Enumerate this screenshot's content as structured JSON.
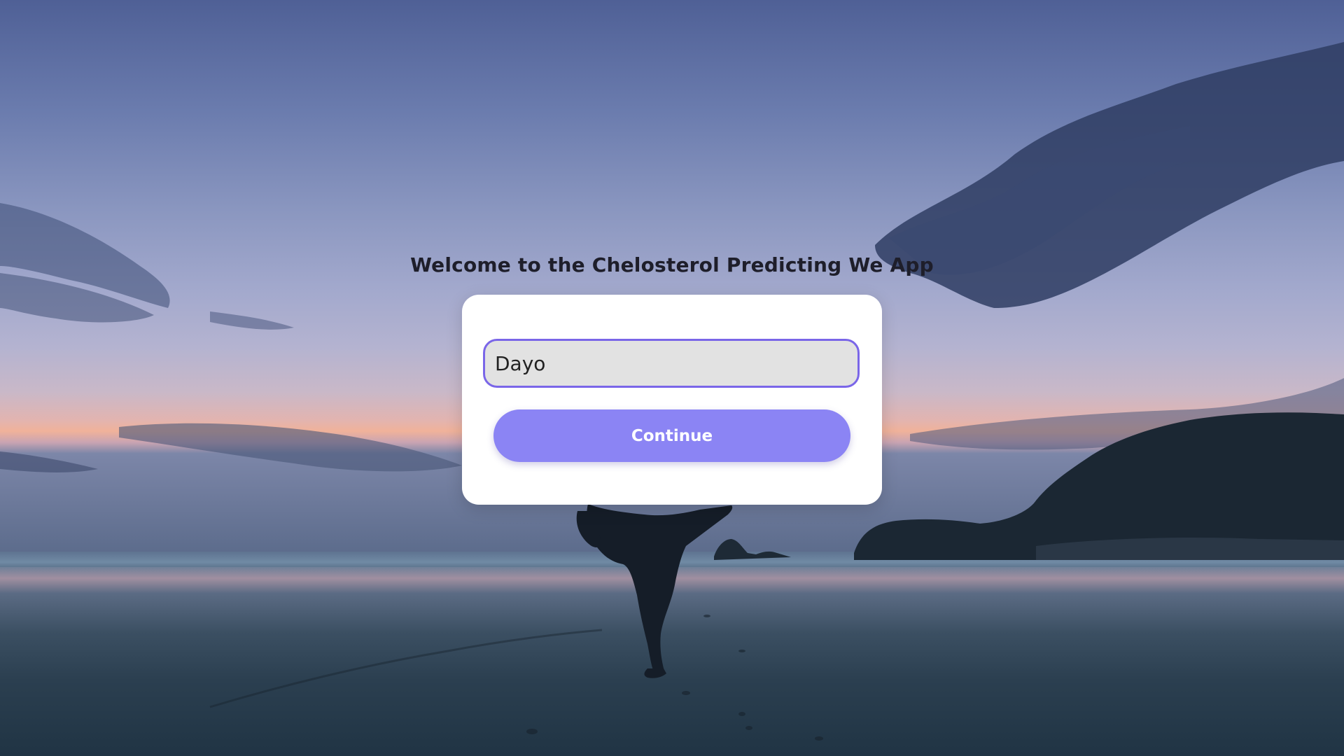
{
  "app": {
    "title": "Welcome to the Chelosterol Predicting We App"
  },
  "form": {
    "name_input": {
      "value": "Dayo",
      "placeholder": ""
    },
    "continue_label": "Continue"
  },
  "colors": {
    "accent": "#8b84f4",
    "input_border": "#7a66e8",
    "input_background": "#e2e2e2",
    "card_background": "#ffffff",
    "title_text": "#1e1e2a"
  }
}
